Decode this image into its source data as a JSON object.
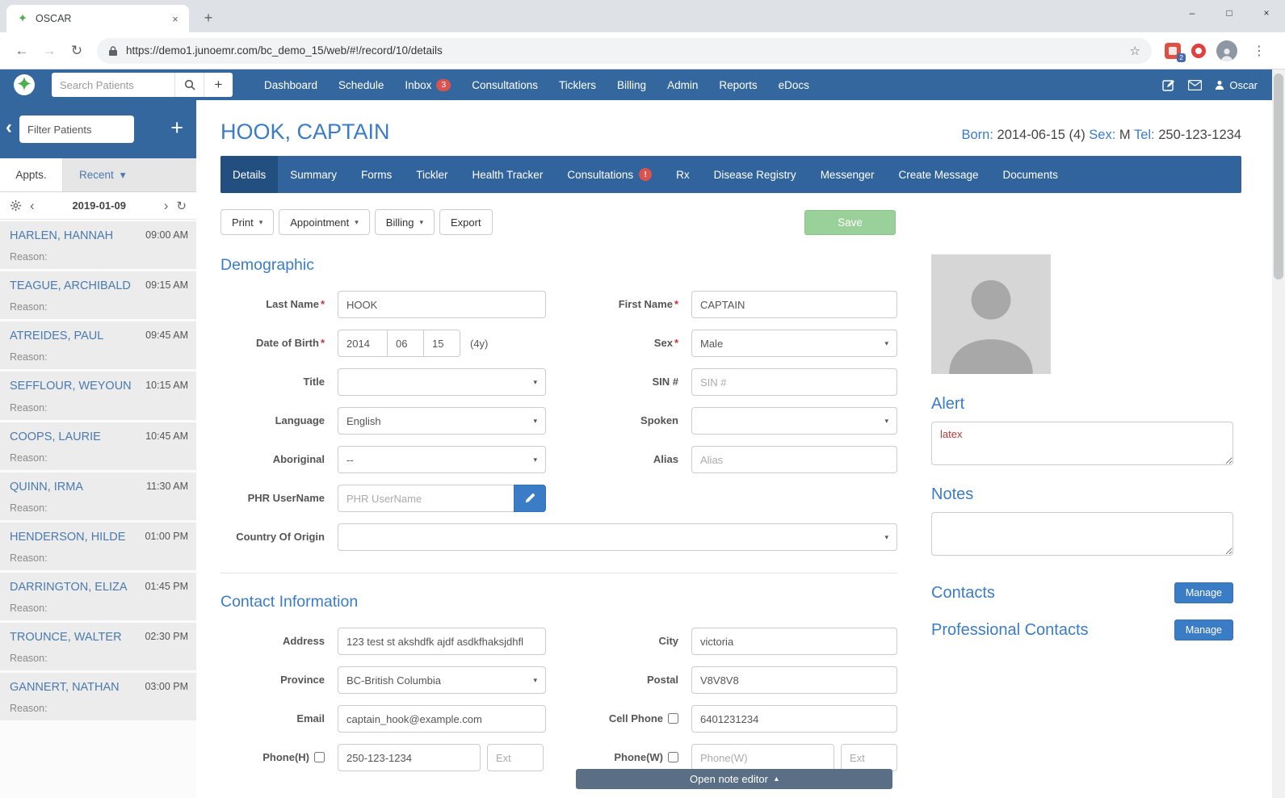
{
  "icons": {
    "close": "×",
    "minimize": "–",
    "maximize": "□",
    "plus": "+",
    "back": "←",
    "forward": "→",
    "refresh": "↻",
    "star": "☆",
    "menu": "⋮",
    "caret_down": "▾",
    "caret_up": "▴",
    "collapse_left": "‹",
    "prev": "‹",
    "next": "›",
    "required": "*"
  },
  "browser": {
    "tab_title": "OSCAR",
    "url": "https://demo1.junoemr.com/bc_demo_15/web/#!/record/10/details",
    "extension_badge": "2"
  },
  "navbar": {
    "search_placeholder": "Search Patients",
    "items": [
      {
        "label": "Dashboard"
      },
      {
        "label": "Schedule"
      },
      {
        "label": "Inbox",
        "badge": "3"
      },
      {
        "label": "Consultations"
      },
      {
        "label": "Ticklers"
      },
      {
        "label": "Billing"
      },
      {
        "label": "Admin"
      },
      {
        "label": "Reports"
      },
      {
        "label": "eDocs"
      }
    ],
    "user": "Oscar"
  },
  "sidebar": {
    "filter_placeholder": "Filter Patients",
    "tab_appts": "Appts.",
    "tab_recent": "Recent",
    "date": "2019-01-09",
    "reason_label": "Reason:",
    "appointments": [
      {
        "name": "HARLEN, HANNAH",
        "time": "09:00 AM"
      },
      {
        "name": "TEAGUE, ARCHIBALD",
        "time": "09:15 AM"
      },
      {
        "name": "ATREIDES, PAUL",
        "time": "09:45 AM"
      },
      {
        "name": "SEFFLOUR, WEYOUN",
        "time": "10:15 AM"
      },
      {
        "name": "COOPS, LAURIE",
        "time": "10:45 AM"
      },
      {
        "name": "QUINN, IRMA",
        "time": "11:30 AM"
      },
      {
        "name": "HENDERSON, HILDE",
        "time": "01:00 PM"
      },
      {
        "name": "DARRINGTON, ELIZA",
        "time": "01:45 PM"
      },
      {
        "name": "TROUNCE, WALTER",
        "time": "02:30 PM"
      },
      {
        "name": "GANNERT, NATHAN",
        "time": "03:00 PM"
      }
    ]
  },
  "patient": {
    "name": "HOOK, CAPTAIN",
    "born_label": "Born:",
    "born_value": "2014-06-15 (4)",
    "sex_label": "Sex:",
    "sex_value": "M",
    "tel_label": "Tel:",
    "tel_value": "250-123-1234"
  },
  "record_tabs": [
    {
      "label": "Details"
    },
    {
      "label": "Summary"
    },
    {
      "label": "Forms"
    },
    {
      "label": "Tickler"
    },
    {
      "label": "Health Tracker"
    },
    {
      "label": "Consultations",
      "badge": "!"
    },
    {
      "label": "Rx"
    },
    {
      "label": "Disease Registry"
    },
    {
      "label": "Messenger"
    },
    {
      "label": "Create Message"
    },
    {
      "label": "Documents"
    }
  ],
  "toolbar": {
    "print": "Print",
    "appointment": "Appointment",
    "billing": "Billing",
    "export": "Export",
    "save": "Save"
  },
  "demographic": {
    "title": "Demographic",
    "last_name": {
      "label": "Last Name",
      "value": "HOOK"
    },
    "first_name": {
      "label": "First Name",
      "value": "CAPTAIN"
    },
    "dob": {
      "label": "Date of Birth",
      "year": "2014",
      "month": "06",
      "day": "15",
      "age": "(4y)"
    },
    "sex": {
      "label": "Sex",
      "value": "Male"
    },
    "title_field": {
      "label": "Title",
      "value": ""
    },
    "sin": {
      "label": "SIN #",
      "placeholder": "SIN #"
    },
    "language": {
      "label": "Language",
      "value": "English"
    },
    "spoken": {
      "label": "Spoken",
      "value": ""
    },
    "aboriginal": {
      "label": "Aboriginal",
      "value": "--"
    },
    "alias": {
      "label": "Alias",
      "placeholder": "Alias"
    },
    "phr": {
      "label": "PHR UserName",
      "placeholder": "PHR UserName"
    },
    "country": {
      "label": "Country Of Origin",
      "value": ""
    }
  },
  "contact": {
    "title": "Contact Information",
    "address": {
      "label": "Address",
      "value": "123 test st akshdfk ajdf asdkfhaksjdhfl"
    },
    "city": {
      "label": "City",
      "value": "victoria"
    },
    "province": {
      "label": "Province",
      "value": "BC-British Columbia"
    },
    "postal": {
      "label": "Postal",
      "value": "V8V8V8"
    },
    "email": {
      "label": "Email",
      "value": "captain_hook@example.com"
    },
    "cell": {
      "label": "Cell Phone",
      "value": "6401231234"
    },
    "phone_h": {
      "label": "Phone(H)",
      "value": "250-123-1234",
      "ext_placeholder": "Ext"
    },
    "phone_w": {
      "label": "Phone(W)",
      "placeholder": "Phone(W)",
      "ext_placeholder": "Ext"
    }
  },
  "panel": {
    "alert_title": "Alert",
    "alert_value": "latex",
    "notes_title": "Notes",
    "notes_value": "",
    "contacts_title": "Contacts",
    "contacts_button": "Manage",
    "professional_title": "Professional Contacts",
    "professional_button": "Manage"
  },
  "footer": {
    "note_editor": "Open note editor"
  },
  "colors": {
    "navbar_blue": "#34679d",
    "tab_active_blue": "#234f80",
    "accent_blue": "#3b7cc6",
    "save_green": "#9ad09a",
    "badge_red": "#d9534f",
    "alert_text_red": "#b33a3a"
  }
}
